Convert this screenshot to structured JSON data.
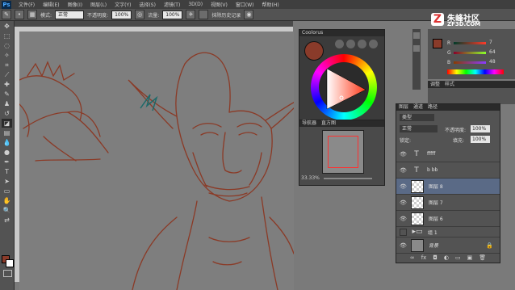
{
  "app": {
    "logo_text": "Ps"
  },
  "menu": [
    "文件(F)",
    "编辑(E)",
    "图像(I)",
    "图层(L)",
    "文字(Y)",
    "选择(S)",
    "滤镜(T)",
    "3D(D)",
    "视图(V)",
    "窗口(W)",
    "帮助(H)"
  ],
  "options": {
    "mode_label": "模式:",
    "mode_value": "正常",
    "opacity_label": "不透明度:",
    "opacity_value": "100%",
    "flow_label": "流量:",
    "flow_value": "100%",
    "history_label": "抹除历史记录"
  },
  "watermark": {
    "brand": "朱峰社区",
    "url": "ZF3D.COM"
  },
  "color_panel": {
    "tabs": [
      "Coolorus"
    ],
    "fg_color": "#8a3b2a",
    "r": "7",
    "g": "64",
    "b": "48",
    "r_label": "R",
    "g_label": "G",
    "b_label": "B"
  },
  "navigator": {
    "tabs": [
      "导航器",
      "直方图"
    ],
    "zoom": "33.33%"
  },
  "adjustments": {
    "tabs": [
      "调整",
      "样式"
    ]
  },
  "layers_panel": {
    "tabs": [
      "图层",
      "通道",
      "路径"
    ],
    "filter_label": "类型",
    "blend_mode": "正常",
    "opacity_label": "不透明度:",
    "opacity_value": "100%",
    "lock_label": "锁定:",
    "fill_label": "填充:",
    "fill_value": "100%",
    "layers": [
      {
        "name": "fffff",
        "kind": "text",
        "selected": false,
        "visible": true
      },
      {
        "name": "b bb",
        "kind": "text",
        "selected": false,
        "visible": true
      },
      {
        "name": "图层 8",
        "kind": "raster",
        "selected": true,
        "visible": true
      },
      {
        "name": "图层 7",
        "kind": "raster",
        "selected": false,
        "visible": true
      },
      {
        "name": "图层 6",
        "kind": "raster",
        "selected": false,
        "visible": true
      },
      {
        "name": "组 1",
        "kind": "group",
        "selected": false,
        "visible": false
      },
      {
        "name": "背景",
        "kind": "background",
        "selected": false,
        "visible": true
      }
    ]
  }
}
